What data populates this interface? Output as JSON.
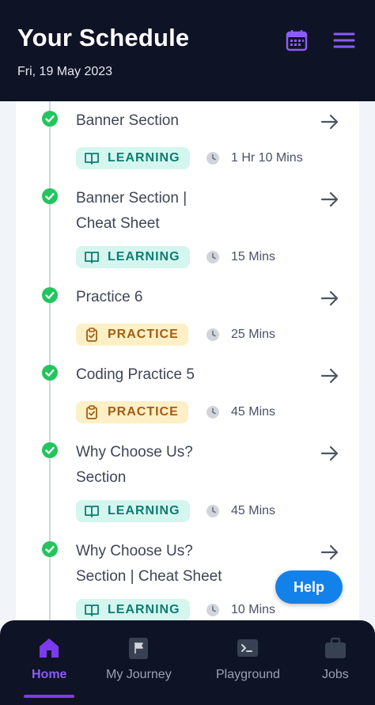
{
  "header": {
    "title": "Your Schedule",
    "date": "Fri, 19 May 2023",
    "calendar_icon": "calendar-icon",
    "menu_icon": "hamburger-menu-icon"
  },
  "schedule": [
    {
      "title_lines": [
        "Banner Section"
      ],
      "type": "LEARNING",
      "duration": "1 Hr 10 Mins",
      "completed": true
    },
    {
      "title_lines": [
        "Banner Section |",
        "Cheat Sheet"
      ],
      "type": "LEARNING",
      "duration": "15 Mins",
      "completed": true
    },
    {
      "title_lines": [
        "Practice 6"
      ],
      "type": "PRACTICE",
      "duration": "25 Mins",
      "completed": true
    },
    {
      "title_lines": [
        "Coding Practice 5"
      ],
      "type": "PRACTICE",
      "duration": "45 Mins",
      "completed": true
    },
    {
      "title_lines": [
        "Why Choose Us?",
        "Section"
      ],
      "type": "LEARNING",
      "duration": "45 Mins",
      "completed": true
    },
    {
      "title_lines": [
        "Why Choose Us?",
        "Section | Cheat Sheet"
      ],
      "type": "LEARNING",
      "duration": "10 Mins",
      "completed": true
    }
  ],
  "help_button": "Help",
  "bottom_nav": [
    {
      "label": "Home",
      "icon": "home-icon",
      "active": true
    },
    {
      "label": "My Journey",
      "icon": "flag-icon",
      "active": false
    },
    {
      "label": "Playground",
      "icon": "terminal-icon",
      "active": false
    },
    {
      "label": "Jobs",
      "icon": "briefcase-icon",
      "active": false
    }
  ],
  "colors": {
    "header_bg": "#0f1326",
    "accent": "#7c3aed",
    "check": "#22c55e",
    "learning_tag_bg": "#d4f6ef",
    "practice_tag_bg": "#fdf0c7",
    "help_bg": "#1282ea"
  }
}
